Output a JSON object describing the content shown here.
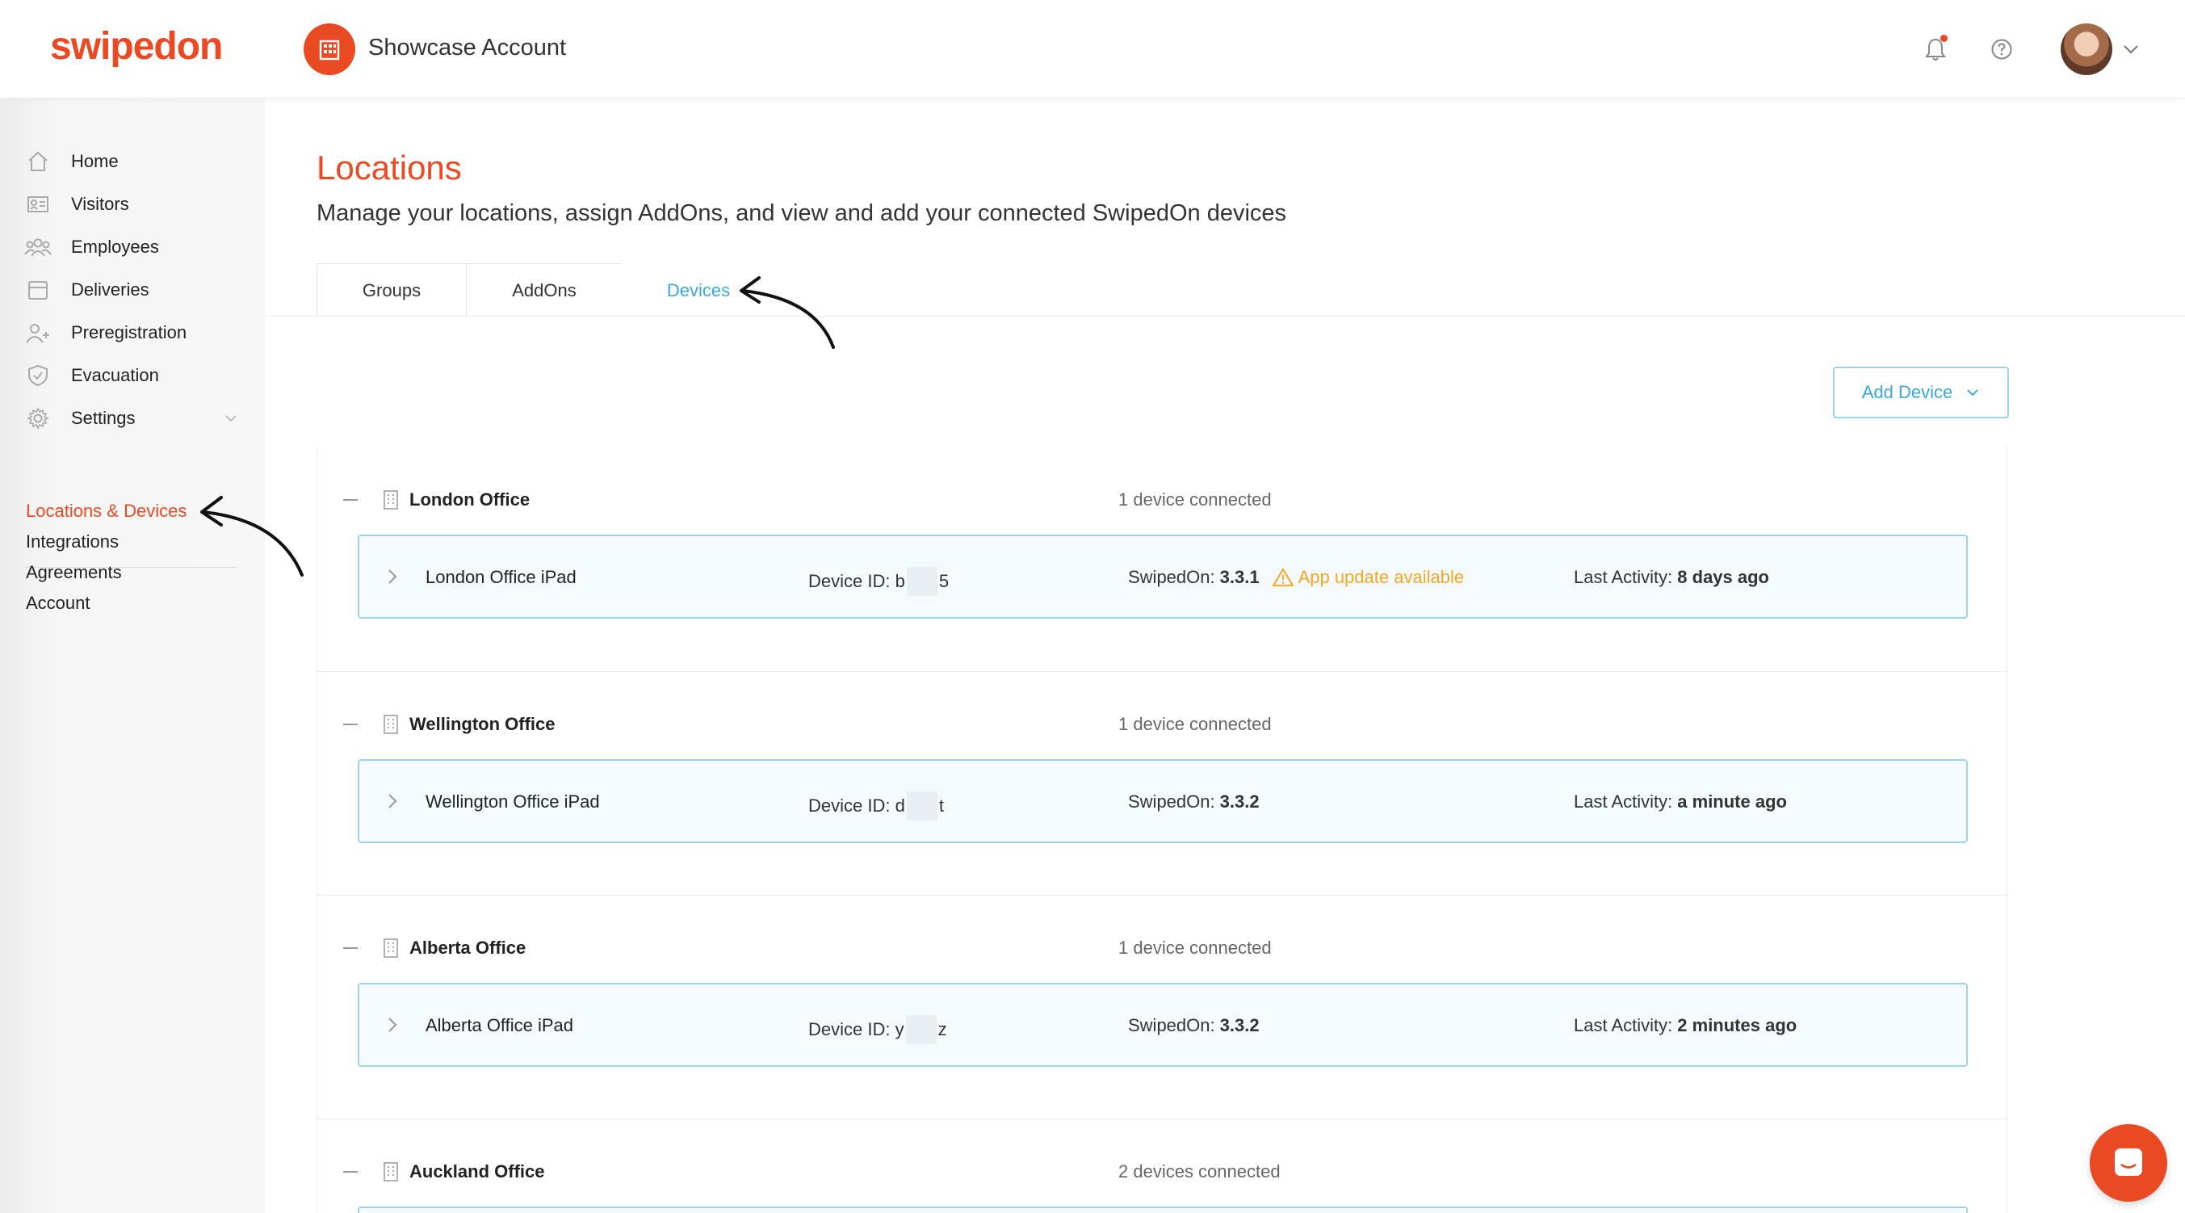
{
  "header": {
    "logo": "swipedon",
    "account_name": "Showcase Account",
    "icons": [
      "bell-icon",
      "help-icon",
      "avatar",
      "chevron-down-icon"
    ]
  },
  "sidebar": {
    "items": [
      {
        "label": "Home",
        "icon": "home-icon"
      },
      {
        "label": "Visitors",
        "icon": "visitor-card-icon"
      },
      {
        "label": "Employees",
        "icon": "employees-icon"
      },
      {
        "label": "Deliveries",
        "icon": "package-icon"
      },
      {
        "label": "Preregistration",
        "icon": "user-plus-icon"
      },
      {
        "label": "Evacuation",
        "icon": "shield-icon"
      },
      {
        "label": "Settings",
        "icon": "gear-icon"
      }
    ],
    "settings_links": [
      {
        "label": "Locations & Devices",
        "active": true
      },
      {
        "label": "Integrations",
        "active": false
      },
      {
        "label": "Agreements",
        "active": false
      },
      {
        "label": "Account",
        "active": false
      }
    ]
  },
  "main": {
    "title": "Locations",
    "subtitle": "Manage your locations, assign AddOns, and view and add your connected SwipedOn devices",
    "tabs": [
      {
        "label": "Groups",
        "active": false
      },
      {
        "label": "AddOns",
        "active": false
      },
      {
        "label": "Devices",
        "active": true
      }
    ],
    "add_device_label": "Add Device",
    "locations": [
      {
        "name": "London Office",
        "count": "1 device connected",
        "device": {
          "name": "London Office iPad",
          "id_label": "Device ID:",
          "id_start": "b",
          "id_end": "5",
          "version_label": "SwipedOn:",
          "version": "3.3.1",
          "update_notice": "App update available",
          "activity_label": "Last Activity:",
          "activity": "8 days ago"
        }
      },
      {
        "name": "Wellington Office",
        "count": "1 device connected",
        "device": {
          "name": "Wellington Office iPad",
          "id_label": "Device ID:",
          "id_start": "d",
          "id_end": "t",
          "version_label": "SwipedOn:",
          "version": "3.3.2",
          "update_notice": "",
          "activity_label": "Last Activity:",
          "activity": "a minute ago"
        }
      },
      {
        "name": "Alberta Office",
        "count": "1 device connected",
        "device": {
          "name": "Alberta Office iPad",
          "id_label": "Device ID:",
          "id_start": "y",
          "id_end": "z",
          "version_label": "SwipedOn:",
          "version": "3.3.2",
          "update_notice": "",
          "activity_label": "Last Activity:",
          "activity": "2 minutes ago"
        }
      },
      {
        "name": "Auckland Office",
        "count": "2 devices connected"
      }
    ]
  },
  "colors": {
    "brand": "#ea4a23",
    "accent": "#3aa9d9",
    "warning": "#f5a623",
    "card_border": "#9fd3ea"
  }
}
